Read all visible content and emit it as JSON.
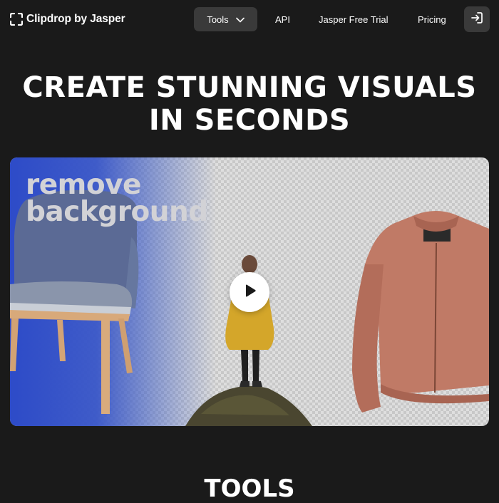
{
  "nav": {
    "logo_text": "Clipdrop by Jasper",
    "tools_label": "Tools",
    "api_label": "API",
    "trial_label": "Jasper Free Trial",
    "pricing_label": "Pricing",
    "login_icon": "login-icon"
  },
  "hero": {
    "title_line1": "CREATE STUNNING VISUALS",
    "title_line2": "IN SECONDS"
  },
  "video": {
    "caption_line1": "remove",
    "caption_line2": "background",
    "play_icon": "play-icon"
  },
  "section": {
    "heading": "TOOLS"
  },
  "colors": {
    "background": "#1a1a1a",
    "nav_button_bg": "#3a3a3a",
    "hero_blue": "#2d4bc8",
    "jacket": "#c07a66",
    "raincoat": "#d4a62a"
  }
}
